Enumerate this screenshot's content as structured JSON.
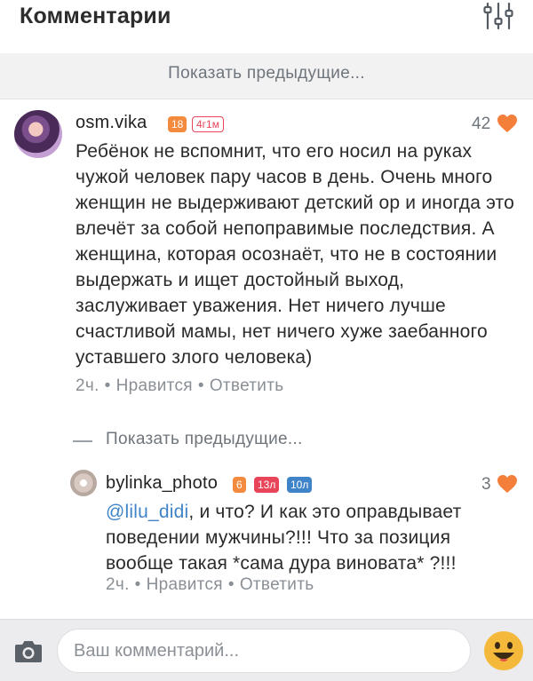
{
  "header": {
    "title": "Комментарии",
    "filter_icon": "sliders-icon"
  },
  "show_previous_top": "Показать предыдущие...",
  "comments": [
    {
      "username": "osm.vika",
      "badges": [
        {
          "text": "18",
          "color": "#f38a3d",
          "style": "filled"
        },
        {
          "text": "4г1м",
          "color": "#e8455a",
          "style": "outline"
        }
      ],
      "likes": "42",
      "text": "Ребёнок не вспомнит, что его носил на руках чужой человек пару часов в день. Очень много женщин не выдерживают детский ор и иногда это влечёт за собой непоправимые последствия. А женщина,  которая осознаёт, что не в состоянии выдержать и ищет достойный выход, заслуживает уважения. Нет ничего лучше счастливой мамы, нет ничего хуже заебанного уставшего злого человека)",
      "time": "2ч.",
      "like_label": "Нравится",
      "reply_label": "Ответить"
    },
    {
      "username": "bylinka_photo",
      "badges": [
        {
          "text": "6",
          "color": "#f38a3d",
          "style": "filled"
        },
        {
          "text": "13л",
          "color": "#e8455a",
          "style": "filled"
        },
        {
          "text": "10л",
          "color": "#3f84c8",
          "style": "filled"
        }
      ],
      "likes": "3",
      "mention": "@lilu_didi",
      "text": ", и что? И как это оправдывает поведении мужчины?!!! Что за позиция вообще такая *сама дура виновата* ?!!!",
      "time": "2ч.",
      "like_label": "Нравится",
      "reply_label": "Ответить"
    }
  ],
  "show_previous_reply": "Показать предыдущие...",
  "input": {
    "placeholder": "Ваш комментарий...",
    "value": ""
  },
  "icons": {
    "camera": "camera-icon",
    "emoji": "emoji-icon",
    "heart": "heart-icon"
  },
  "colors": {
    "heart": "#f37f3a",
    "link": "#3f84c8",
    "emoji": "#f4b93a"
  }
}
